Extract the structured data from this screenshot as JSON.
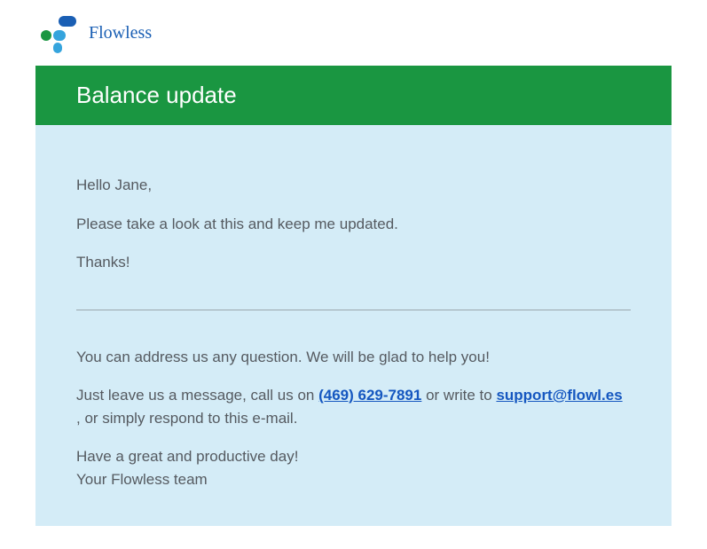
{
  "brand": {
    "name": "Flowless"
  },
  "email": {
    "subject": "Balance update",
    "greeting": "Hello Jane,",
    "body_line1": "Please take a look at this and keep me updated.",
    "body_line2": "Thanks!",
    "help_line": "You can address us any question. We will be glad to help you!",
    "contact_prefix": "Just leave us a message, call us on ",
    "phone": "(469) 629-7891",
    "contact_mid": " or write to ",
    "support_email": "support@flowl.es",
    "contact_suffix": " , or simply respond to this e-mail.",
    "closing_line1": "Have a great and productive day!",
    "closing_line2": "Your Flowless team"
  }
}
